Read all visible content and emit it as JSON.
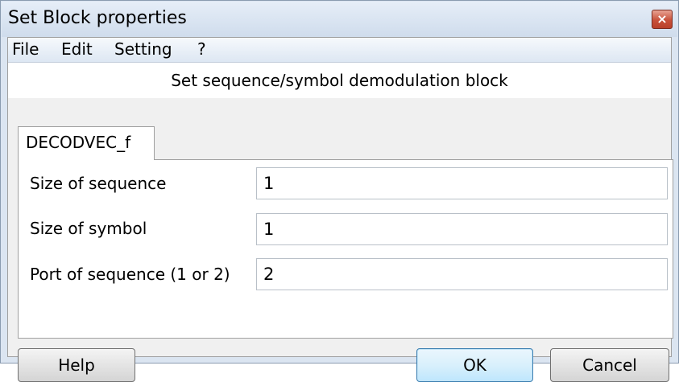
{
  "window": {
    "title": "Set Block properties",
    "close_glyph": "×"
  },
  "menubar": {
    "items": [
      "File",
      "Edit",
      "Setting",
      "?"
    ]
  },
  "header": {
    "subtitle": "Set sequence/symbol demodulation block"
  },
  "tabs": [
    {
      "label": "DECODVEC_f"
    }
  ],
  "fields": [
    {
      "label": "Size of sequence",
      "value": "1"
    },
    {
      "label": "Size of symbol",
      "value": "1"
    },
    {
      "label": "Port of sequence (1 or 2)",
      "value": "2"
    }
  ],
  "buttons": {
    "help": "Help",
    "ok": "OK",
    "cancel": "Cancel"
  },
  "colors": {
    "title_gradient_top": "#e6eef8",
    "close_red": "#c8513a",
    "default_button_border": "#3c7fb1"
  },
  "icons": {
    "close": "close-icon"
  }
}
